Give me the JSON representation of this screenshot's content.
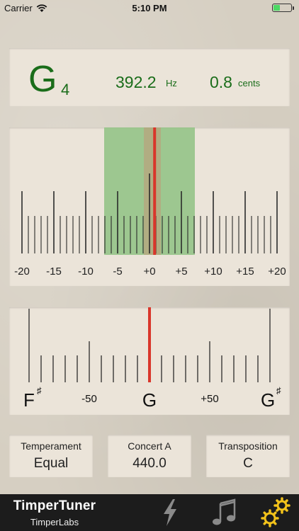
{
  "status_bar": {
    "carrier": "Carrier",
    "time": "5:10 PM",
    "battery_icon": "battery-charging-icon",
    "wifi_icon": "wifi-icon"
  },
  "readout": {
    "note_letter": "G",
    "note_octave": "4",
    "frequency": "392.2",
    "frequency_unit": "Hz",
    "cents": "0.8",
    "cents_unit": "cents",
    "color": "#1a6d1a"
  },
  "cents_meter": {
    "tick_labels": [
      "-20",
      "-15",
      "-10",
      "-5",
      "+0",
      "+5",
      "+10",
      "+15",
      "+20"
    ],
    "needle_value_cents": 0.8,
    "in_tune_band_cents": [
      -6,
      6
    ],
    "band_color": "#8fc283",
    "needle_color": "#d9362b"
  },
  "pitch_meter": {
    "left_note": "F",
    "left_accidental": "♯",
    "left_offset_label": "-50",
    "center_note": "G",
    "right_offset_label": "+50",
    "right_note": "G",
    "right_accidental": "♯",
    "needle_color": "#d9362b"
  },
  "settings": [
    {
      "label": "Temperament",
      "value": "Equal"
    },
    {
      "label": "Concert A",
      "value": "440.0"
    },
    {
      "label": "Transposition",
      "value": "C"
    }
  ],
  "tab_bar": {
    "app_name": "TimperTuner",
    "company": "TimperLabs",
    "tabs": [
      {
        "name": "tuner-tab",
        "icon": "lightning-bolt-icon"
      },
      {
        "name": "tone-tab",
        "icon": "music-note-icon"
      },
      {
        "name": "settings-tab",
        "icon": "gears-icon",
        "color": "#f2c21b"
      }
    ]
  }
}
